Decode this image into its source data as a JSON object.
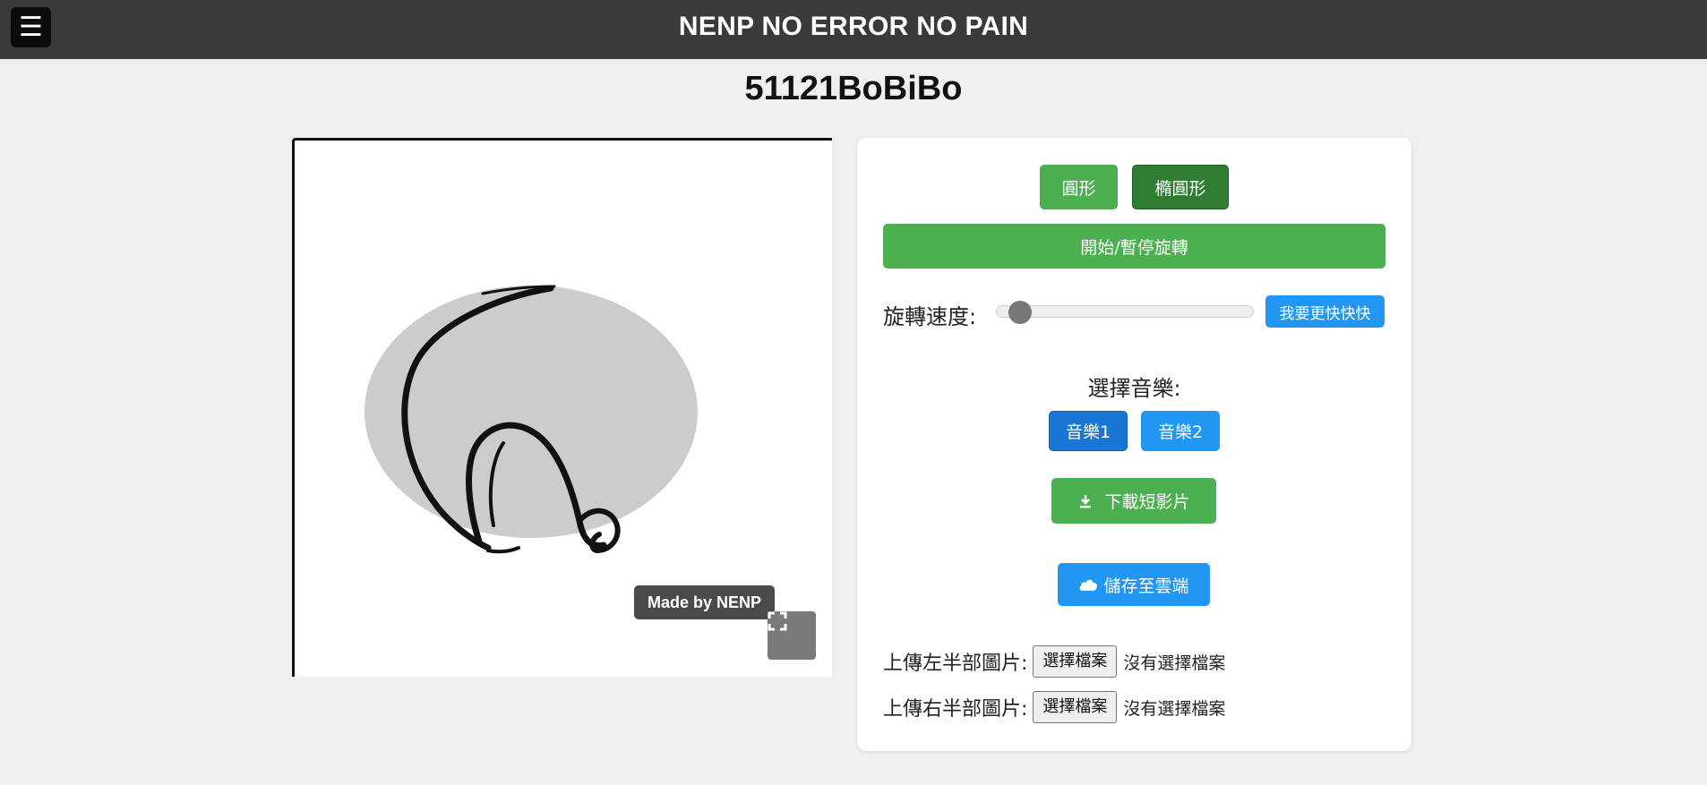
{
  "header": {
    "menu_icon": "☰",
    "title": "NENP NO ERROR NO PAIN",
    "background": "#3a3a3a"
  },
  "page": {
    "title": "51121BoBiBo"
  },
  "canvas": {
    "watermark": "Made by NENP",
    "fullscreen_icon": "fullscreen-icon",
    "ellipse_color": "#cccccc"
  },
  "controls": {
    "shape_circle": "圓形",
    "shape_ellipse": "橢圓形",
    "rotate_toggle": "開始/暫停旋轉",
    "speed_label": "旋轉速度:",
    "speed_value": 0.05,
    "faster_button": "我要更快快快",
    "music_label": "選擇音樂:",
    "music1": "音樂1",
    "music2": "音樂2",
    "download_button": "下載短影片",
    "download_icon": "download-icon",
    "cloud_button": "儲存至雲端",
    "cloud_icon": "cloud-icon"
  },
  "uploads": {
    "left_label": "上傳左半部圖片:",
    "right_label": "上傳右半部圖片:",
    "choose_file": "選擇檔案",
    "no_file": "沒有選擇檔案"
  },
  "colors": {
    "green": "#4caf50",
    "green_active": "#2e7d32",
    "blue": "#2196f3",
    "blue_active": "#1976d2"
  }
}
